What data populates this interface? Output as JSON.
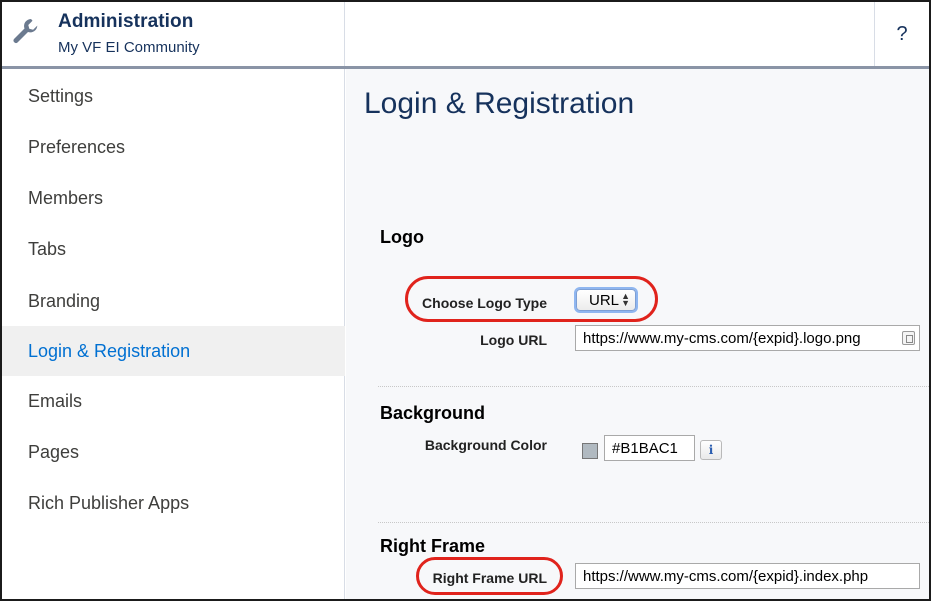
{
  "header": {
    "title": "Administration",
    "subtitle": "My VF EI Community",
    "help_label": "?"
  },
  "sidebar": {
    "items": [
      {
        "label": "Settings"
      },
      {
        "label": "Preferences"
      },
      {
        "label": "Members"
      },
      {
        "label": "Tabs"
      },
      {
        "label": "Branding"
      },
      {
        "label": "Login & Registration",
        "active": true
      },
      {
        "label": "Emails"
      },
      {
        "label": "Pages"
      },
      {
        "label": "Rich Publisher Apps"
      }
    ]
  },
  "main": {
    "title": "Login & Registration",
    "logo_section": {
      "title": "Logo",
      "choose_type_label": "Choose Logo Type",
      "choose_type_value": "URL",
      "logo_url_label": "Logo URL",
      "logo_url_value": "https://www.my-cms.com/{expid}.logo.png"
    },
    "background_section": {
      "title": "Background",
      "color_label": "Background Color",
      "color_value": "#B1BAC1",
      "info_label": "i"
    },
    "right_frame_section": {
      "title": "Right Frame",
      "url_label": "Right Frame URL",
      "url_value": "https://www.my-cms.com/{expid}.index.php"
    }
  },
  "colors": {
    "accent": "#0070d2",
    "highlight_oval": "#e0231c",
    "swatch": "#B1BAC1"
  }
}
